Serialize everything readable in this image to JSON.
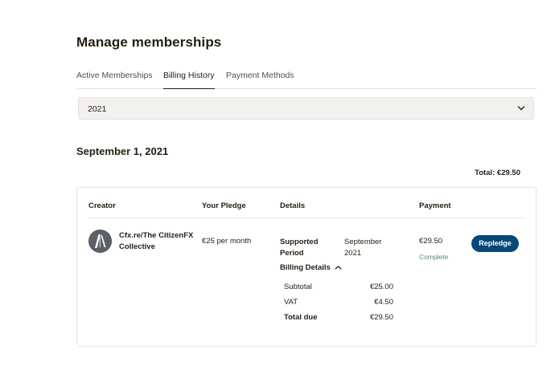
{
  "page": {
    "title": "Manage memberships"
  },
  "tabs": [
    {
      "label": "Active Memberships"
    },
    {
      "label": "Billing History",
      "active": true
    },
    {
      "label": "Payment Methods"
    }
  ],
  "year_select": {
    "selected": "2021"
  },
  "billing": {
    "date_heading": "September 1, 2021",
    "total": "Total: €29.50",
    "columns": {
      "creator": "Creator",
      "pledge": "Your Pledge",
      "details": "Details",
      "payment": "Payment"
    },
    "row": {
      "creator_name": "Cfx.re/The CitizenFX Collective",
      "pledge": "€25 per month",
      "supported_period_label": "Supported Period",
      "supported_period_value": "September 2021",
      "billing_details_label": "Billing Details",
      "billing_details": [
        {
          "label": "Subtotal",
          "amount": "€25.00"
        },
        {
          "label": "VAT",
          "amount": "€4.50"
        },
        {
          "label": "Total due",
          "amount": "€29.50"
        }
      ],
      "payment_amount": "€29.50",
      "payment_status": "Complete",
      "repledge_label": "Repledge"
    }
  },
  "icons": {
    "year_chevron": "chevron-down-icon",
    "billing_caret": "chevron-up-icon",
    "avatar": "creator-avatar-logo"
  },
  "colors": {
    "primary_button": "#06487a",
    "status_complete": "#4e8a86",
    "select_background": "#f2f1ee"
  }
}
